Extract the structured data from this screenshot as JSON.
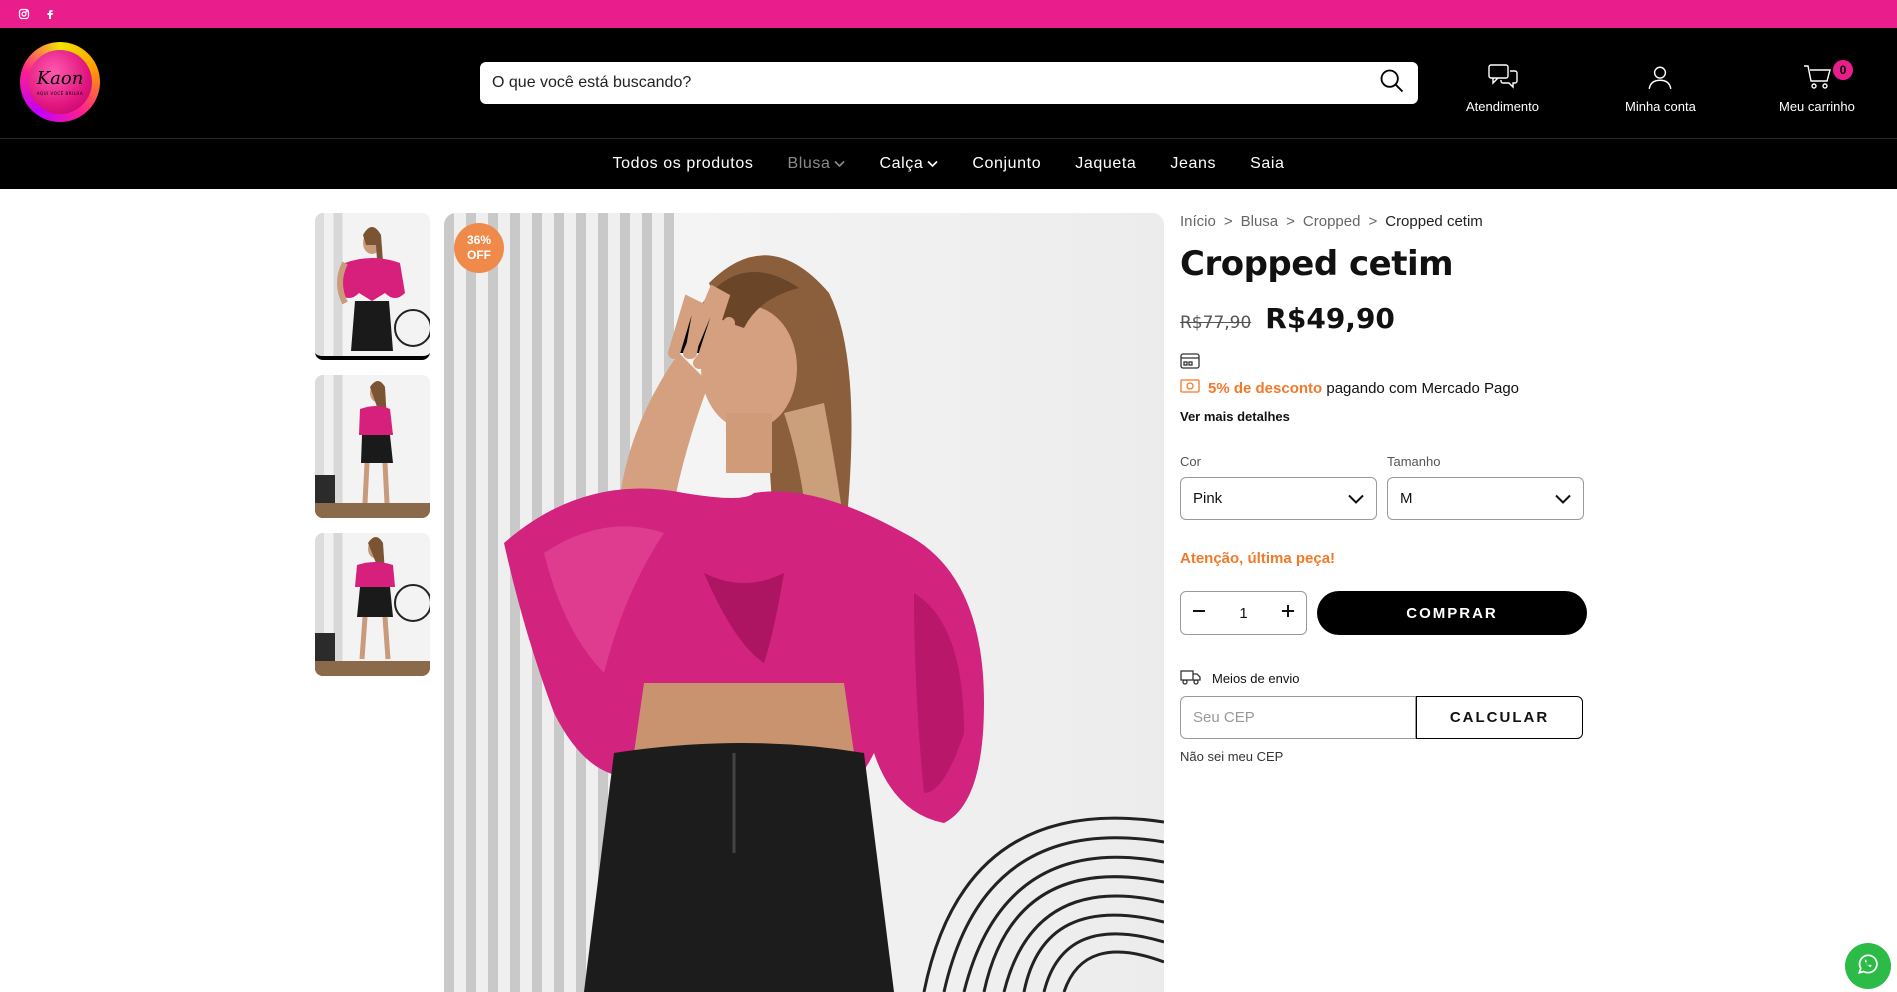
{
  "topbar": {
    "icons": [
      "instagram-icon",
      "facebook-icon"
    ],
    "color": "#e91e8c"
  },
  "header": {
    "logo": {
      "script": "Kaon",
      "tagline": "AQUI VOCÊ BRILHA"
    },
    "search": {
      "placeholder": "O que você está buscando?"
    },
    "actions": {
      "support": "Atendimento",
      "account": "Minha conta",
      "cart": "Meu carrinho",
      "cart_count": "0"
    }
  },
  "nav": {
    "items": [
      {
        "label": "Todos os produtos",
        "dropdown": false
      },
      {
        "label": "Blusa",
        "dropdown": true
      },
      {
        "label": "Calça",
        "dropdown": true
      },
      {
        "label": "Conjunto",
        "dropdown": false
      },
      {
        "label": "Jaqueta",
        "dropdown": false
      },
      {
        "label": "Jeans",
        "dropdown": false
      },
      {
        "label": "Saia",
        "dropdown": false
      }
    ]
  },
  "product": {
    "badge": {
      "pct": "36%",
      "off": "OFF"
    },
    "breadcrumb": [
      "Início",
      ">",
      "Blusa",
      ">",
      "Cropped",
      ">",
      "Cropped cetim"
    ],
    "title": "Cropped cetim",
    "old_price": "R$77,90",
    "price": "R$49,90",
    "discount": {
      "pct": "5% de desconto",
      "rest": "pagando com Mercado Pago"
    },
    "more_details": "Ver mais detalhes",
    "color": {
      "label": "Cor",
      "value": "Pink"
    },
    "size": {
      "label": "Tamanho",
      "value": "M"
    },
    "warning": "Atenção, última peça!",
    "quantity": "1",
    "buy": "COMPRAR",
    "shipping": {
      "label": "Meios de envio",
      "placeholder": "Seu CEP",
      "calc": "CALCULAR",
      "nocep": "Não sei meu CEP"
    }
  },
  "colors": {
    "accent": "#e91e8c",
    "orange": "#f07a2a",
    "whatsapp": "#2dbb47"
  }
}
